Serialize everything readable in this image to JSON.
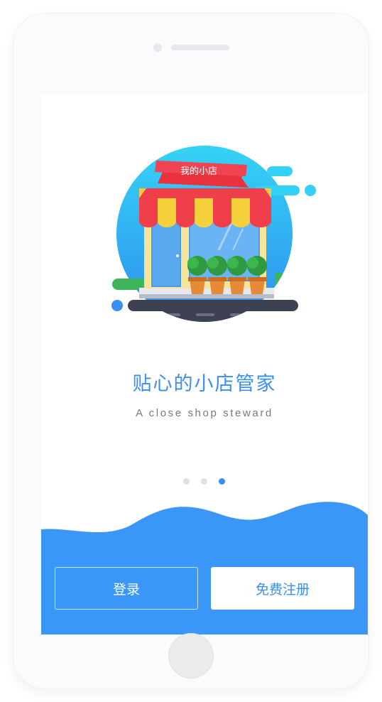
{
  "illustration": {
    "flag_text": "我的小店"
  },
  "onboarding": {
    "headline": "贴心的小店管家",
    "subtitle": "A close shop steward",
    "page_count": 3,
    "active_page": 3
  },
  "actions": {
    "login_label": "登录",
    "register_label": "免费注册"
  },
  "colors": {
    "accent": "#3a8ef0",
    "wave": "#3a96f7",
    "inactive_dot": "#e0e0e0"
  }
}
